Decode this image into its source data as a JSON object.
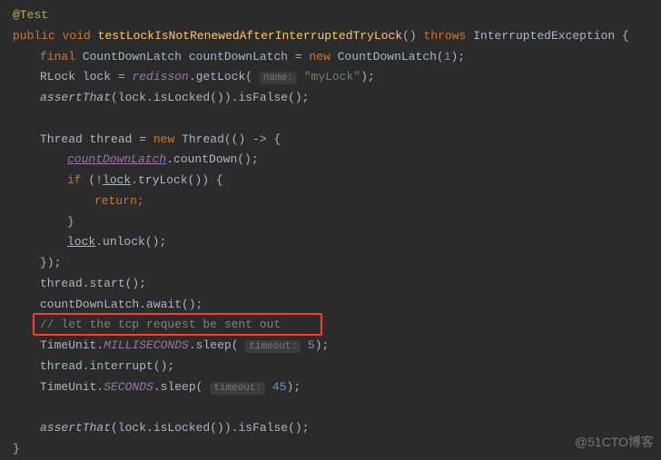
{
  "code": {
    "annotation": "@Test",
    "modifiers": {
      "public": "public",
      "void": "void"
    },
    "method_name": "testLockIsNotRenewedAfterInterruptedTryLock",
    "throws_kw": "throws",
    "exception": "InterruptedException",
    "final_kw": "final",
    "cdl_type": "CountDownLatch",
    "cdl_var": "countDownLatch",
    "new_kw": "new",
    "cdl_arg": "1",
    "rlock_type": "RLock",
    "lock_var": "lock",
    "redisson": "redisson",
    "getLock": "getLock",
    "name_hint": "name:",
    "mylock_str": "\"myLock\"",
    "assertThat": "assertThat",
    "isLocked": "isLocked",
    "isFalse": "isFalse",
    "thread_type": "Thread",
    "thread_var": "thread",
    "countDown": "countDown",
    "if_kw": "if",
    "tryLock": "tryLock",
    "return_kw": "return",
    "unlock": "unlock",
    "start": "start",
    "await": "await",
    "comment_tcp": "// let the tcp request be sent out",
    "timeunit": "TimeUnit",
    "millis": "MILLISECONDS",
    "seconds": "SECONDS",
    "sleep": "sleep",
    "timeout_hint": "timeout:",
    "timeout_5": "5",
    "timeout_45": "45",
    "interrupt": "interrupt"
  },
  "watermark": "@51CTO博客"
}
